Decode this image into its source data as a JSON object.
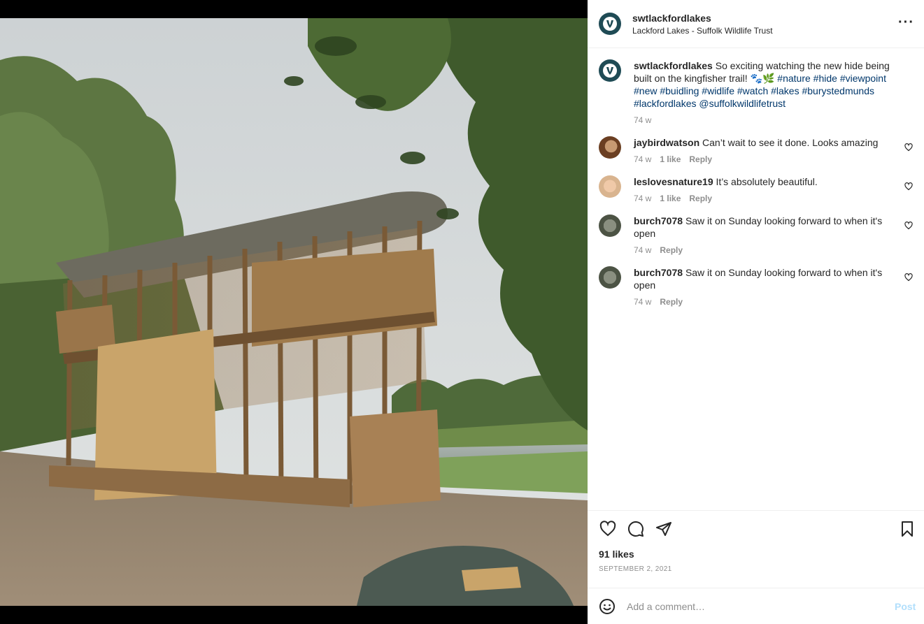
{
  "post": {
    "username": "swtlackfordlakes",
    "location": "Lackford Lakes - Suffolk Wildlife Trust",
    "more_icon": "more-horizontal-icon"
  },
  "caption": {
    "username": "swtlackfordlakes",
    "text": "So exciting watching the new hide being built on the kingfisher trail! 🐾🌿",
    "tags_line1": "#nature #hide #viewpoint",
    "tags_line2": "#new #buidling #widlife #watch #lakes #burystedmunds",
    "tags_line3": "#lackfordlakes @suffolkwildlifetrust",
    "time": "74 w"
  },
  "comments": [
    {
      "username": "jaybirdwatson",
      "text": "Can’t wait to see it done. Looks amazing",
      "time": "74 w",
      "likes": "1 like",
      "reply": "Reply"
    },
    {
      "username": "leslovesnature19",
      "text": "It’s absolutely beautiful.",
      "time": "74 w",
      "likes": "1 like",
      "reply": "Reply"
    },
    {
      "username": "burch7078",
      "text": "Saw it on Sunday looking forward to when it's open",
      "time": "74 w",
      "reply": "Reply"
    },
    {
      "username": "burch7078",
      "text": "Saw it on Sunday looking forward to when it's open",
      "time": "74 w",
      "reply": "Reply"
    }
  ],
  "footer": {
    "likes": "91 likes",
    "date": "SEPTEMBER 2, 2021",
    "comment_placeholder": "Add a comment…",
    "post_label": "Post"
  },
  "colors": {
    "link": "#00376b",
    "secondary_text": "#8e8e8e",
    "post_button_disabled": "#b2dffc",
    "divider": "#efefef"
  }
}
